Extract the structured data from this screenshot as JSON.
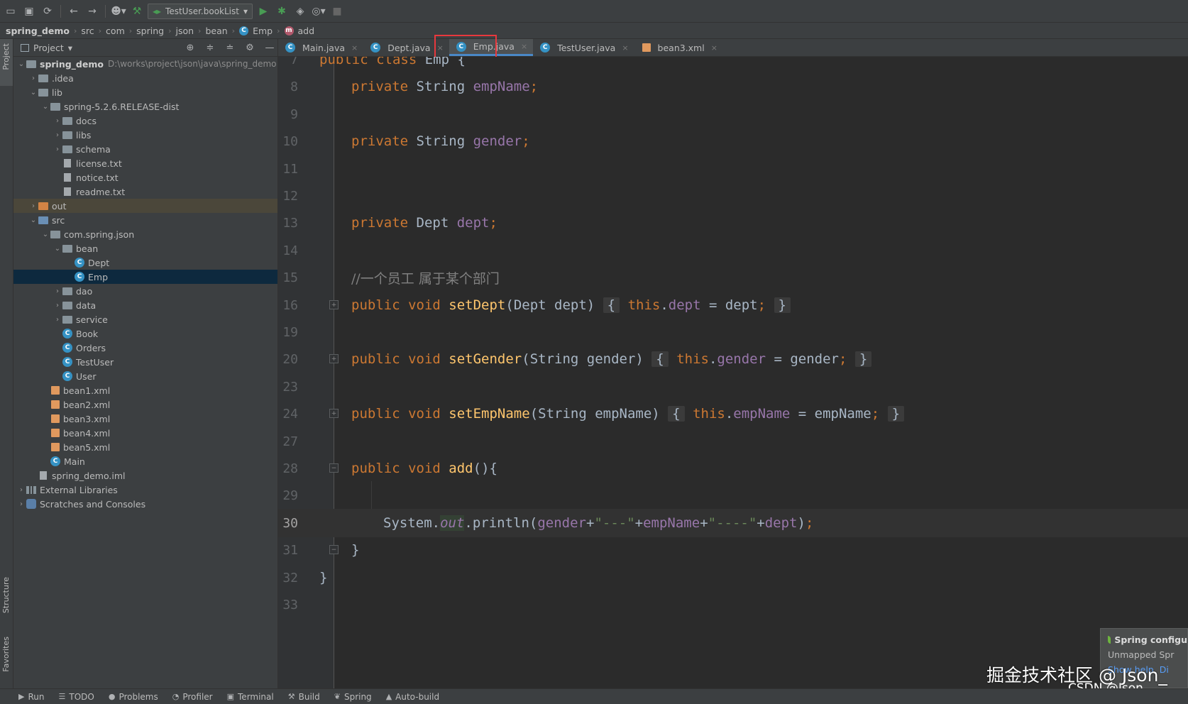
{
  "toolbar": {
    "run_config": "TestUser.bookList"
  },
  "breadcrumb": [
    "spring_demo",
    "src",
    "com",
    "spring",
    "json",
    "bean",
    "Emp",
    "add"
  ],
  "left_strip": {
    "project": "Project",
    "structure": "Structure",
    "favorites": "Favorites"
  },
  "project_panel": {
    "title": "Project",
    "tree": [
      {
        "label": "spring_demo",
        "path": "D:\\works\\project\\json\\java\\spring_demo",
        "indent": 0,
        "arrow": "down",
        "icon": "folder"
      },
      {
        "label": ".idea",
        "indent": 1,
        "arrow": "right",
        "icon": "folder"
      },
      {
        "label": "lib",
        "indent": 1,
        "arrow": "down",
        "icon": "folder"
      },
      {
        "label": "spring-5.2.6.RELEASE-dist",
        "indent": 2,
        "arrow": "down",
        "icon": "folder"
      },
      {
        "label": "docs",
        "indent": 3,
        "arrow": "right",
        "icon": "folder"
      },
      {
        "label": "libs",
        "indent": 3,
        "arrow": "right",
        "icon": "folder"
      },
      {
        "label": "schema",
        "indent": 3,
        "arrow": "right",
        "icon": "folder"
      },
      {
        "label": "license.txt",
        "indent": 3,
        "arrow": "",
        "icon": "file"
      },
      {
        "label": "notice.txt",
        "indent": 3,
        "arrow": "",
        "icon": "file"
      },
      {
        "label": "readme.txt",
        "indent": 3,
        "arrow": "",
        "icon": "file"
      },
      {
        "label": "out",
        "indent": 1,
        "arrow": "right",
        "icon": "folder-orange"
      },
      {
        "label": "src",
        "indent": 1,
        "arrow": "down",
        "icon": "folder-blue"
      },
      {
        "label": "com.spring.json",
        "indent": 2,
        "arrow": "down",
        "icon": "folder"
      },
      {
        "label": "bean",
        "indent": 3,
        "arrow": "down",
        "icon": "folder"
      },
      {
        "label": "Dept",
        "indent": 4,
        "arrow": "",
        "icon": "class"
      },
      {
        "label": "Emp",
        "indent": 4,
        "arrow": "",
        "icon": "class"
      },
      {
        "label": "dao",
        "indent": 3,
        "arrow": "right",
        "icon": "folder"
      },
      {
        "label": "data",
        "indent": 3,
        "arrow": "right",
        "icon": "folder"
      },
      {
        "label": "service",
        "indent": 3,
        "arrow": "right",
        "icon": "folder"
      },
      {
        "label": "Book",
        "indent": 3,
        "arrow": "",
        "icon": "class"
      },
      {
        "label": "Orders",
        "indent": 3,
        "arrow": "",
        "icon": "class"
      },
      {
        "label": "TestUser",
        "indent": 3,
        "arrow": "",
        "icon": "class"
      },
      {
        "label": "User",
        "indent": 3,
        "arrow": "",
        "icon": "class"
      },
      {
        "label": "bean1.xml",
        "indent": 2,
        "arrow": "",
        "icon": "xml"
      },
      {
        "label": "bean2.xml",
        "indent": 2,
        "arrow": "",
        "icon": "xml"
      },
      {
        "label": "bean3.xml",
        "indent": 2,
        "arrow": "",
        "icon": "xml"
      },
      {
        "label": "bean4.xml",
        "indent": 2,
        "arrow": "",
        "icon": "xml"
      },
      {
        "label": "bean5.xml",
        "indent": 2,
        "arrow": "",
        "icon": "xml"
      },
      {
        "label": "Main",
        "indent": 2,
        "arrow": "",
        "icon": "class"
      },
      {
        "label": "spring_demo.iml",
        "indent": 1,
        "arrow": "",
        "icon": "file"
      },
      {
        "label": "External Libraries",
        "indent": 0,
        "arrow": "right",
        "icon": "lib"
      },
      {
        "label": "Scratches and Consoles",
        "indent": 0,
        "arrow": "right",
        "icon": "scratch"
      }
    ]
  },
  "tabs": [
    {
      "label": "Main.java",
      "active": false
    },
    {
      "label": "Dept.java",
      "active": false
    },
    {
      "label": "Emp.java",
      "active": true
    },
    {
      "label": "TestUser.java",
      "active": false
    },
    {
      "label": "bean3.xml",
      "active": false
    }
  ],
  "editor": {
    "line_numbers": [
      "7",
      "8",
      "9",
      "10",
      "11",
      "12",
      "13",
      "14",
      "15",
      "16",
      "19",
      "20",
      "23",
      "24",
      "27",
      "28",
      "29",
      "30",
      "31",
      "32",
      "33"
    ],
    "current_line": "30",
    "comment_text": "//一个员工 属于某个部门",
    "class_decl": "public class Emp {"
  },
  "notification": {
    "title": "Spring configu",
    "subtitle": "Unmapped Spr",
    "link1": "Show help",
    "link2": "Di"
  },
  "watermark": {
    "main": "掘金技术社区 @ Json_",
    "sub": "CSDN @Json____"
  },
  "statusbar": [
    "Run",
    "TODO",
    "Problems",
    "Profiler",
    "Terminal",
    "Build",
    "Spring",
    "Auto-build"
  ],
  "colors": {
    "keyword": "#cc7832",
    "field": "#9876aa",
    "method": "#ffc66d",
    "string": "#6a8759",
    "highlight_box": "#e8383d",
    "selection": "#0d293e"
  }
}
